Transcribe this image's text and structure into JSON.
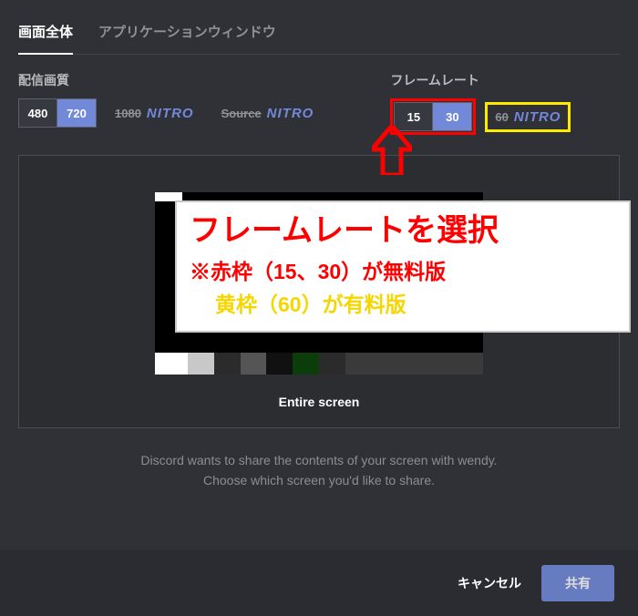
{
  "tabs": {
    "entire": "画面全体",
    "appwin": "アプリケーションウィンドウ"
  },
  "quality": {
    "label": "配信画質",
    "b480": "480",
    "b720": "720",
    "nitro1": {
      "px": "1080",
      "word": "NITRO"
    },
    "nitro2": {
      "px": "Source",
      "word": "NITRO"
    }
  },
  "framerate": {
    "label": "フレームレート",
    "b15": "15",
    "b30": "30",
    "nitro": {
      "px": "60",
      "word": "NITRO"
    }
  },
  "preview": {
    "label": "Entire screen"
  },
  "info": {
    "l1": "Discord wants to share the contents of your screen with wendy.",
    "l2": "Choose which screen you'd like to share."
  },
  "footer": {
    "cancel": "キャンセル",
    "share": "共有"
  },
  "callout": {
    "l1": "フレームレートを選択",
    "l2": "※赤枠（15、30）が無料版",
    "l3": "黄枠（60）が有料版"
  }
}
